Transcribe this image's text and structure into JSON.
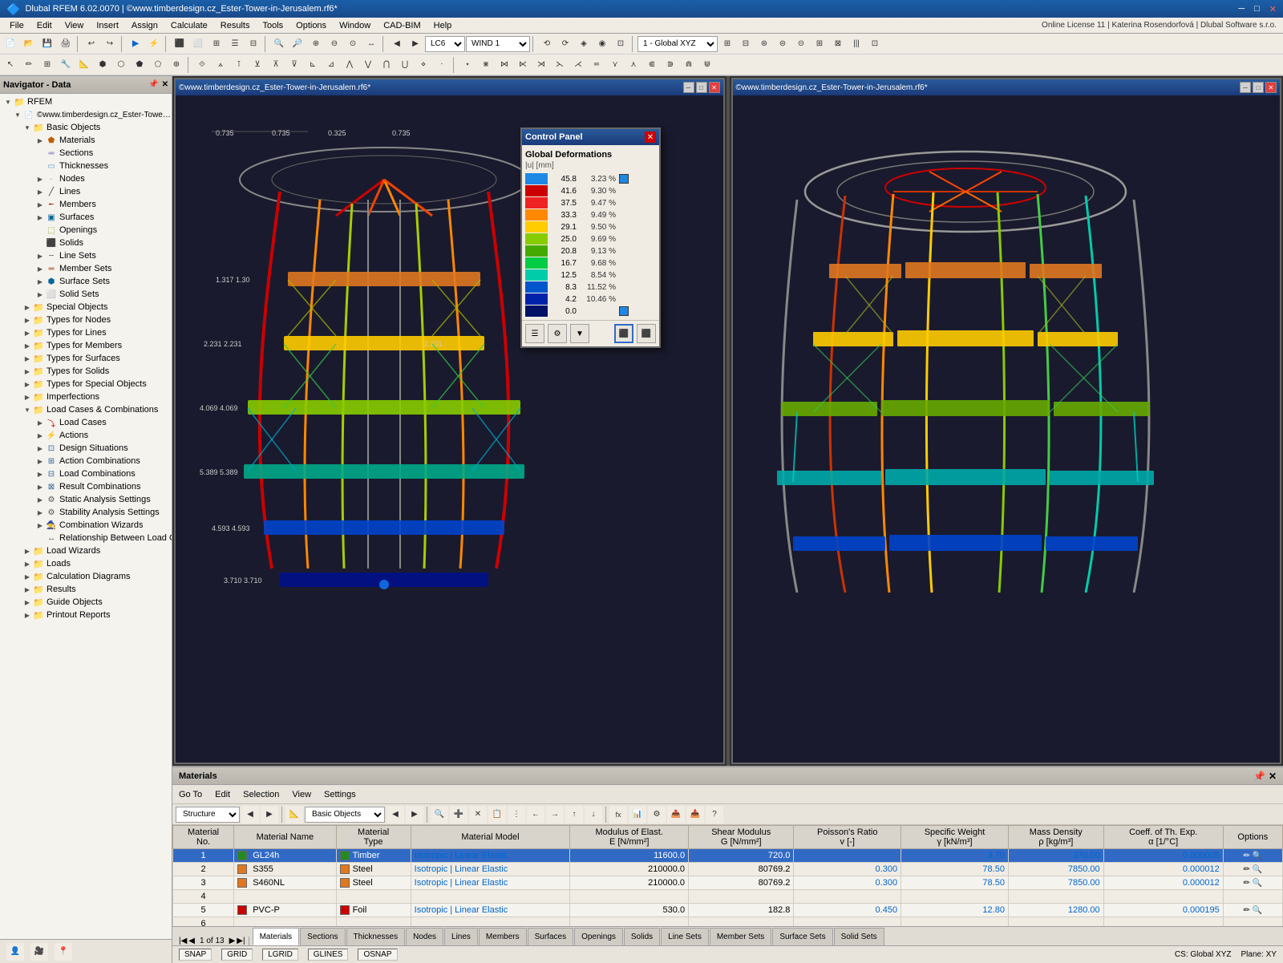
{
  "app": {
    "title": "Dlubal RFEM 6.02.0070 | ©www.timberdesign.cz_Ester-Tower-in-Jerusalem.rf6*",
    "license": "Online License 11 | Katerina Rosendorfová | Dlubal Software s.r.o."
  },
  "menus": [
    "File",
    "Edit",
    "View",
    "Insert",
    "Assign",
    "Calculate",
    "Results",
    "Tools",
    "Options",
    "Window",
    "CAD-BIM",
    "Help"
  ],
  "toolbar1": {
    "lc_dropdown": "LC6",
    "wind_label": "WIND 1",
    "global_xyz": "1 - Global XYZ"
  },
  "navigator": {
    "title": "Navigator - Data",
    "root": "RFEM",
    "project": "©www.timberdesign.cz_Ester-Tower-in-Jeru...",
    "tree": [
      {
        "id": "basic-objects",
        "label": "Basic Objects",
        "level": 1,
        "expanded": true,
        "type": "folder"
      },
      {
        "id": "materials",
        "label": "Materials",
        "level": 2,
        "type": "folder"
      },
      {
        "id": "sections",
        "label": "Sections",
        "level": 2,
        "type": "section"
      },
      {
        "id": "thicknesses",
        "label": "Thicknesses",
        "level": 2,
        "type": "section"
      },
      {
        "id": "nodes",
        "label": "Nodes",
        "level": 2,
        "type": "node"
      },
      {
        "id": "lines",
        "label": "Lines",
        "level": 2,
        "type": "line"
      },
      {
        "id": "members",
        "label": "Members",
        "level": 2,
        "type": "member"
      },
      {
        "id": "surfaces",
        "label": "Surfaces",
        "level": 2,
        "type": "surface"
      },
      {
        "id": "openings",
        "label": "Openings",
        "level": 2,
        "type": "opening"
      },
      {
        "id": "solids",
        "label": "Solids",
        "level": 2,
        "type": "solid"
      },
      {
        "id": "line-sets",
        "label": "Line Sets",
        "level": 2,
        "type": "folder"
      },
      {
        "id": "member-sets",
        "label": "Member Sets",
        "level": 2,
        "type": "folder"
      },
      {
        "id": "surface-sets",
        "label": "Surface Sets",
        "level": 2,
        "type": "folder"
      },
      {
        "id": "solid-sets",
        "label": "Solid Sets",
        "level": 2,
        "type": "folder"
      },
      {
        "id": "special-objects",
        "label": "Special Objects",
        "level": 1,
        "type": "folder"
      },
      {
        "id": "types-nodes",
        "label": "Types for Nodes",
        "level": 1,
        "type": "folder"
      },
      {
        "id": "types-lines",
        "label": "Types for Lines",
        "level": 1,
        "type": "folder"
      },
      {
        "id": "types-members",
        "label": "Types for Members",
        "level": 1,
        "type": "folder"
      },
      {
        "id": "types-surfaces",
        "label": "Types for Surfaces",
        "level": 1,
        "type": "folder"
      },
      {
        "id": "types-solids",
        "label": "Types for Solids",
        "level": 1,
        "type": "folder"
      },
      {
        "id": "types-special",
        "label": "Types for Special Objects",
        "level": 1,
        "type": "folder"
      },
      {
        "id": "imperfections",
        "label": "Imperfections",
        "level": 1,
        "type": "folder"
      },
      {
        "id": "load-cases-comb",
        "label": "Load Cases & Combinations",
        "level": 1,
        "expanded": true,
        "type": "folder"
      },
      {
        "id": "load-cases",
        "label": "Load Cases",
        "level": 2,
        "type": "folder"
      },
      {
        "id": "actions",
        "label": "Actions",
        "level": 2,
        "type": "folder"
      },
      {
        "id": "design-situations",
        "label": "Design Situations",
        "level": 2,
        "type": "folder"
      },
      {
        "id": "action-combinations",
        "label": "Action Combinations",
        "level": 2,
        "type": "folder"
      },
      {
        "id": "load-combinations",
        "label": "Load Combinations",
        "level": 2,
        "type": "folder"
      },
      {
        "id": "result-combinations",
        "label": "Result Combinations",
        "level": 2,
        "type": "folder"
      },
      {
        "id": "static-analysis",
        "label": "Static Analysis Settings",
        "level": 2,
        "type": "folder"
      },
      {
        "id": "stability-analysis",
        "label": "Stability Analysis Settings",
        "level": 2,
        "type": "folder"
      },
      {
        "id": "combination-wizards",
        "label": "Combination Wizards",
        "level": 2,
        "type": "folder"
      },
      {
        "id": "relationship-load",
        "label": "Relationship Between Load Cases",
        "level": 2,
        "type": "folder"
      },
      {
        "id": "load-wizards",
        "label": "Load Wizards",
        "level": 1,
        "type": "folder"
      },
      {
        "id": "loads",
        "label": "Loads",
        "level": 1,
        "type": "folder"
      },
      {
        "id": "calc-diagrams",
        "label": "Calculation Diagrams",
        "level": 1,
        "type": "folder"
      },
      {
        "id": "results",
        "label": "Results",
        "level": 1,
        "type": "folder"
      },
      {
        "id": "guide-objects",
        "label": "Guide Objects",
        "level": 1,
        "type": "folder"
      },
      {
        "id": "printout-reports",
        "label": "Printout Reports",
        "level": 1,
        "type": "folder"
      }
    ]
  },
  "view1": {
    "title": "©www.timberdesign.cz_Ester-Tower-in-Jerusalem.rf6*",
    "labels": [
      "0.735",
      "0.735",
      "0.325",
      "0.735",
      "1.317",
      "1.30",
      "2.231",
      "2.231",
      "2.231",
      "4.069",
      "4.069",
      "5.389",
      "5.389",
      "4.593",
      "4.593",
      "3.710",
      "3.710"
    ]
  },
  "view2": {
    "title": "©www.timberdesign.cz_Ester-Tower-in-Jerusalem.rf6*"
  },
  "control_panel": {
    "title": "Control Panel",
    "section": "Global Deformations",
    "unit": "|u| [mm]",
    "legend": [
      {
        "value": "45.8",
        "percent": "3.23 %",
        "color": "#1e88e5"
      },
      {
        "value": "41.6",
        "percent": "9.30 %",
        "color": "#cc0000"
      },
      {
        "value": "37.5",
        "percent": "9.47 %",
        "color": "#ee2222"
      },
      {
        "value": "33.3",
        "percent": "9.49 %",
        "color": "#ff8800"
      },
      {
        "value": "29.1",
        "percent": "9.50 %",
        "color": "#ffcc00"
      },
      {
        "value": "25.0",
        "percent": "9.69 %",
        "color": "#88cc00"
      },
      {
        "value": "20.8",
        "percent": "9.13 %",
        "color": "#44aa00"
      },
      {
        "value": "16.7",
        "percent": "9.68 %",
        "color": "#00cc44"
      },
      {
        "value": "12.5",
        "percent": "8.54 %",
        "color": "#00ccaa"
      },
      {
        "value": "8.3",
        "percent": "11.52 %",
        "color": "#0055cc"
      },
      {
        "value": "4.2",
        "percent": "10.46 %",
        "color": "#0022aa"
      },
      {
        "value": "0.0",
        "percent": "",
        "color": "#1e88e5"
      }
    ]
  },
  "materials_panel": {
    "title": "Materials",
    "nav_items": [
      "Go To",
      "Edit",
      "Selection",
      "View",
      "Settings"
    ],
    "structure_label": "Structure",
    "basic_objects": "Basic Objects",
    "columns": [
      "Material No.",
      "Material Name",
      "Material Type",
      "Material Model",
      "Modulus of Elast. E [N/mm²]",
      "Shear Modulus G [N/mm²]",
      "Poisson's Ratio v [-]",
      "Specific Weight γ [kN/m³]",
      "Mass Density ρ [kg/m³]",
      "Coeff. of Th. Exp. α [1/°C]",
      "Options"
    ],
    "rows": [
      {
        "no": "1",
        "name": "GL24h",
        "color": "#228B22",
        "type": "Timber",
        "model": "Isotropic | Linear Elastic",
        "E": "11600.0",
        "G": "720.0",
        "v": "",
        "gamma": "3.70",
        "rho": "370.00",
        "alpha": "0.000005"
      },
      {
        "no": "2",
        "name": "S355",
        "color": "#e07820",
        "type": "Steel",
        "model": "Isotropic | Linear Elastic",
        "E": "210000.0",
        "G": "80769.2",
        "v": "0.300",
        "gamma": "78.50",
        "rho": "7850.00",
        "alpha": "0.000012"
      },
      {
        "no": "3",
        "name": "S460NL",
        "color": "#e07820",
        "type": "Steel",
        "model": "Isotropic | Linear Elastic",
        "E": "210000.0",
        "G": "80769.2",
        "v": "0.300",
        "gamma": "78.50",
        "rho": "7850.00",
        "alpha": "0.000012"
      },
      {
        "no": "4",
        "name": "",
        "color": "",
        "type": "",
        "model": "",
        "E": "",
        "G": "",
        "v": "",
        "gamma": "",
        "rho": "",
        "alpha": ""
      },
      {
        "no": "5",
        "name": "PVC-P",
        "color": "#cc0000",
        "type": "Foil",
        "model": "Isotropic | Linear Elastic",
        "E": "530.0",
        "G": "182.8",
        "v": "0.450",
        "gamma": "12.80",
        "rho": "1280.00",
        "alpha": "0.000195"
      },
      {
        "no": "6",
        "name": "",
        "color": "",
        "type": "",
        "model": "",
        "E": "",
        "G": "",
        "v": "",
        "gamma": "",
        "rho": "",
        "alpha": ""
      }
    ]
  },
  "bottom_tabs": [
    "Materials",
    "Sections",
    "Thicknesses",
    "Nodes",
    "Lines",
    "Members",
    "Surfaces",
    "Openings",
    "Solids",
    "Line Sets",
    "Member Sets",
    "Surface Sets",
    "Solid Sets"
  ],
  "active_tab": "Materials",
  "status_bar": {
    "page": "1 of 13",
    "items": [
      "SNAP",
      "GRID",
      "LGRID",
      "GLINES",
      "OSNAP"
    ],
    "cs": "CS: Global XYZ",
    "plane": "Plane: XY"
  }
}
